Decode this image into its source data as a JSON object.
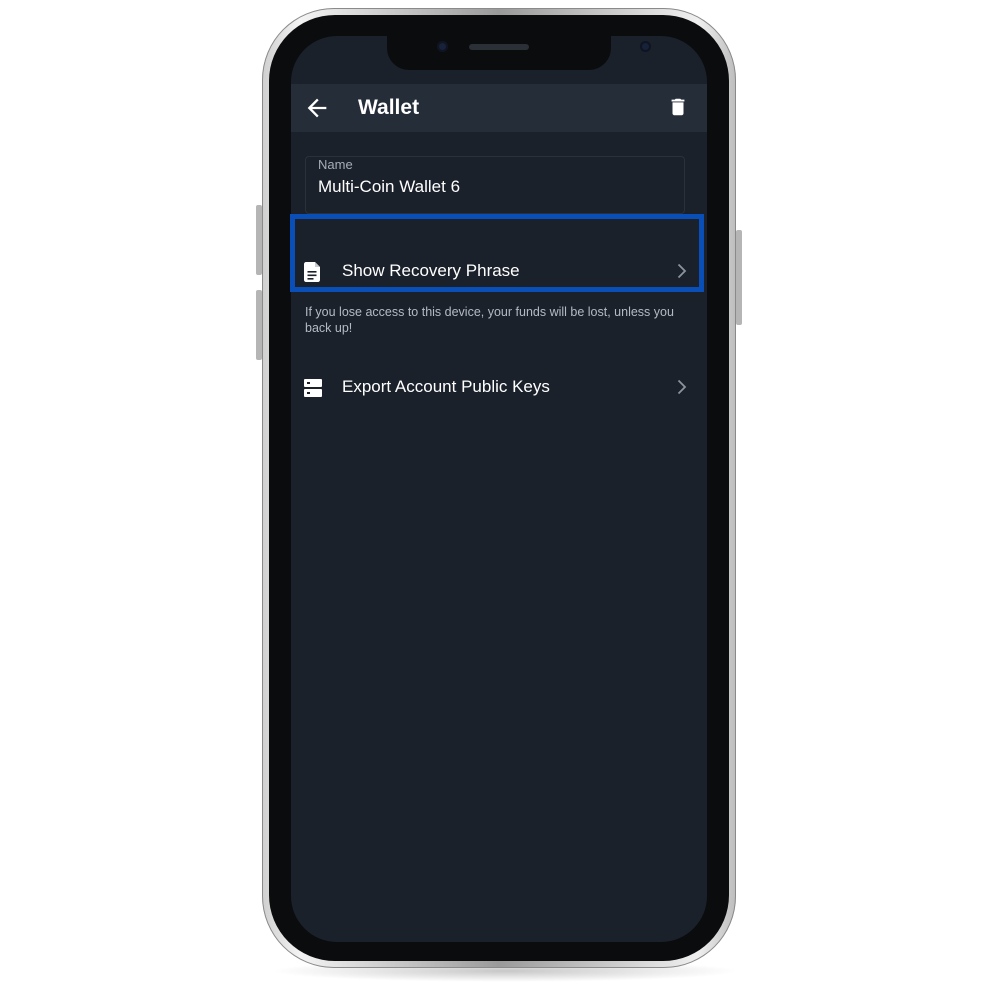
{
  "app_bar": {
    "title": "Wallet",
    "back_icon": "arrow-left-icon",
    "delete_icon": "trash-icon"
  },
  "name_field": {
    "label": "Name",
    "value": "Multi-Coin Wallet 6"
  },
  "items": [
    {
      "label": "Show Recovery Phrase",
      "icon": "document-icon",
      "highlighted": true
    },
    {
      "label": "Export Account Public Keys",
      "icon": "server-icon",
      "highlighted": false
    }
  ],
  "helper_text": "If you lose access to this device, your funds will be lost, unless you back up!",
  "colors": {
    "screen_bg": "#1b212b",
    "app_bar_bg": "#252d39",
    "highlight_border": "#0a4fb8",
    "text_primary": "#ffffff",
    "text_secondary": "#b5bac2"
  }
}
